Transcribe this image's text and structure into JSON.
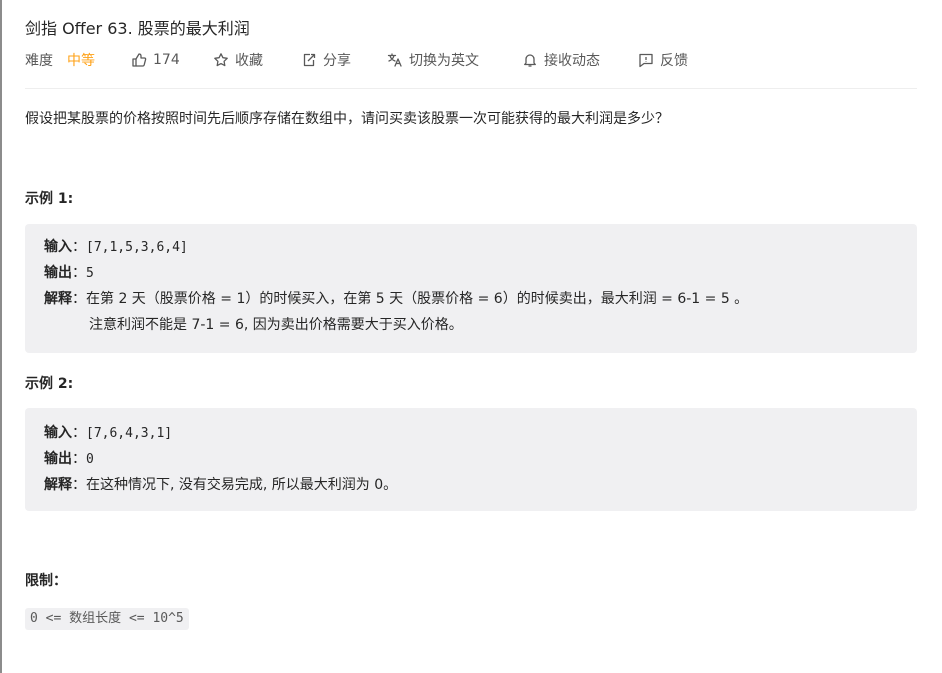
{
  "problem": {
    "title": "剑指 Offer 63. 股票的最大利润"
  },
  "meta": {
    "difficulty_label": "难度",
    "difficulty_value": "中等",
    "likes": "174",
    "favorite": "收藏",
    "share": "分享",
    "switch_language": "切换为英文",
    "notify": "接收动态",
    "feedback": "反馈",
    "difficulty_color": "#ffa116",
    "icons": [
      "thumbs-up-icon",
      "star-icon",
      "share-icon",
      "translate-icon",
      "bell-icon",
      "feedback-icon"
    ]
  },
  "description": "假设把某股票的价格按照时间先后顺序存储在数组中，请问买卖该股票一次可能获得的最大利润是多少？",
  "example1": {
    "heading": "示例 1:",
    "input_label": "输入",
    "input_value": "[7,1,5,3,6,4]",
    "output_label": "输出",
    "output_value": "5",
    "explain_label": "解释",
    "explain_line1": "在第 2 天（股票价格 = 1）的时候买入，在第 5 天（股票价格 = 6）的时候卖出，最大利润 = 6-1 = 5 。",
    "explain_line2": "注意利润不能是 7-1 = 6, 因为卖出价格需要大于买入价格。"
  },
  "example2": {
    "heading": "示例 2:",
    "input_label": "输入",
    "input_value": "[7,6,4,3,1]",
    "output_label": "输出",
    "output_value": "0",
    "explain_label": "解释",
    "explain_line1": "在这种情况下, 没有交易完成, 所以最大利润为 0。"
  },
  "constraints": {
    "heading": "限制：",
    "text": "0 <= 数组长度 <= 10^5"
  },
  "colon": "："
}
